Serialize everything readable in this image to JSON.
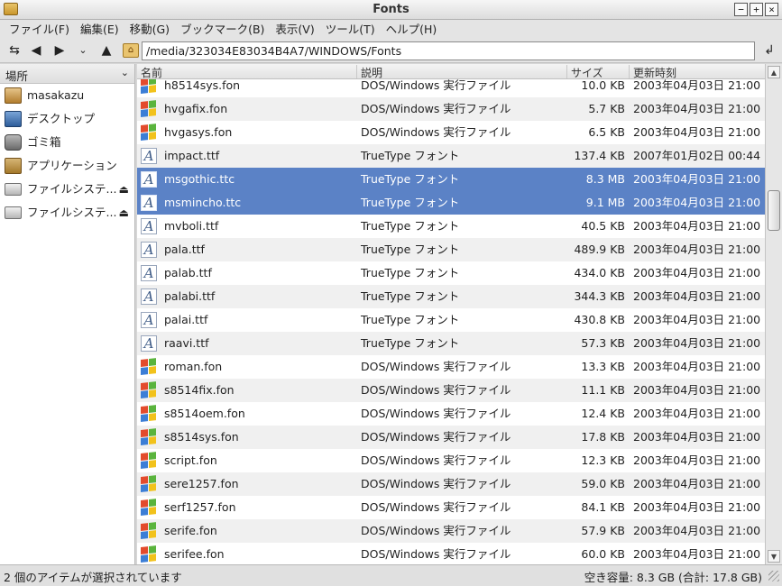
{
  "window": {
    "title": "Fonts"
  },
  "menu": [
    "ファイル(F)",
    "編集(E)",
    "移動(G)",
    "ブックマーク(B)",
    "表示(V)",
    "ツール(T)",
    "ヘルプ(H)"
  ],
  "toolbar": {
    "path": "/media/323034E83034B4A7/WINDOWS/Fonts"
  },
  "sidebar": {
    "header": "場所",
    "items": [
      {
        "label": "masakazu",
        "icon": "home-folder-icon"
      },
      {
        "label": "デスクトップ",
        "icon": "desktop-icon"
      },
      {
        "label": "ゴミ箱",
        "icon": "trash-icon"
      },
      {
        "label": "アプリケーション",
        "icon": "applications-icon"
      },
      {
        "label": "ファイルシステ...",
        "icon": "drive-icon"
      },
      {
        "label": "ファイルシステ...",
        "icon": "drive-icon"
      }
    ]
  },
  "columns": {
    "name": "名前",
    "type": "説明",
    "size": "サイズ",
    "date": "更新時刻"
  },
  "files": [
    {
      "name": "h8514sys.fon",
      "type": "DOS/Windows 実行ファイル",
      "size": "10.0 KB",
      "date": "2003年04月03日 21:00",
      "icon": "windows-exe-icon"
    },
    {
      "name": "hvgafix.fon",
      "type": "DOS/Windows 実行ファイル",
      "size": "5.7 KB",
      "date": "2003年04月03日 21:00",
      "icon": "windows-exe-icon"
    },
    {
      "name": "hvgasys.fon",
      "type": "DOS/Windows 実行ファイル",
      "size": "6.5 KB",
      "date": "2003年04月03日 21:00",
      "icon": "windows-exe-icon"
    },
    {
      "name": "impact.ttf",
      "type": "TrueType フォント",
      "size": "137.4 KB",
      "date": "2007年01月02日 00:44",
      "icon": "font-icon"
    },
    {
      "name": "msgothic.ttc",
      "type": "TrueType フォント",
      "size": "8.3 MB",
      "date": "2003年04月03日 21:00",
      "icon": "font-icon",
      "selected": true
    },
    {
      "name": "msmincho.ttc",
      "type": "TrueType フォント",
      "size": "9.1 MB",
      "date": "2003年04月03日 21:00",
      "icon": "font-icon",
      "selected": true
    },
    {
      "name": "mvboli.ttf",
      "type": "TrueType フォント",
      "size": "40.5 KB",
      "date": "2003年04月03日 21:00",
      "icon": "font-icon"
    },
    {
      "name": "pala.ttf",
      "type": "TrueType フォント",
      "size": "489.9 KB",
      "date": "2003年04月03日 21:00",
      "icon": "font-icon"
    },
    {
      "name": "palab.ttf",
      "type": "TrueType フォント",
      "size": "434.0 KB",
      "date": "2003年04月03日 21:00",
      "icon": "font-icon"
    },
    {
      "name": "palabi.ttf",
      "type": "TrueType フォント",
      "size": "344.3 KB",
      "date": "2003年04月03日 21:00",
      "icon": "font-icon"
    },
    {
      "name": "palai.ttf",
      "type": "TrueType フォント",
      "size": "430.8 KB",
      "date": "2003年04月03日 21:00",
      "icon": "font-icon"
    },
    {
      "name": "raavi.ttf",
      "type": "TrueType フォント",
      "size": "57.3 KB",
      "date": "2003年04月03日 21:00",
      "icon": "font-icon"
    },
    {
      "name": "roman.fon",
      "type": "DOS/Windows 実行ファイル",
      "size": "13.3 KB",
      "date": "2003年04月03日 21:00",
      "icon": "windows-exe-icon"
    },
    {
      "name": "s8514fix.fon",
      "type": "DOS/Windows 実行ファイル",
      "size": "11.1 KB",
      "date": "2003年04月03日 21:00",
      "icon": "windows-exe-icon"
    },
    {
      "name": "s8514oem.fon",
      "type": "DOS/Windows 実行ファイル",
      "size": "12.4 KB",
      "date": "2003年04月03日 21:00",
      "icon": "windows-exe-icon"
    },
    {
      "name": "s8514sys.fon",
      "type": "DOS/Windows 実行ファイル",
      "size": "17.8 KB",
      "date": "2003年04月03日 21:00",
      "icon": "windows-exe-icon"
    },
    {
      "name": "script.fon",
      "type": "DOS/Windows 実行ファイル",
      "size": "12.3 KB",
      "date": "2003年04月03日 21:00",
      "icon": "windows-exe-icon"
    },
    {
      "name": "sere1257.fon",
      "type": "DOS/Windows 実行ファイル",
      "size": "59.0 KB",
      "date": "2003年04月03日 21:00",
      "icon": "windows-exe-icon"
    },
    {
      "name": "serf1257.fon",
      "type": "DOS/Windows 実行ファイル",
      "size": "84.1 KB",
      "date": "2003年04月03日 21:00",
      "icon": "windows-exe-icon"
    },
    {
      "name": "serife.fon",
      "type": "DOS/Windows 実行ファイル",
      "size": "57.9 KB",
      "date": "2003年04月03日 21:00",
      "icon": "windows-exe-icon"
    },
    {
      "name": "serifee.fon",
      "type": "DOS/Windows 実行ファイル",
      "size": "60.0 KB",
      "date": "2003年04月03日 21:00",
      "icon": "windows-exe-icon"
    }
  ],
  "status": {
    "left": "2 個のアイテムが選択されています",
    "right": "空き容量: 8.3 GB (合計: 17.8 GB)"
  },
  "colors": {
    "selection": "#5b82c6",
    "alt_row": "#f0f0f0"
  }
}
